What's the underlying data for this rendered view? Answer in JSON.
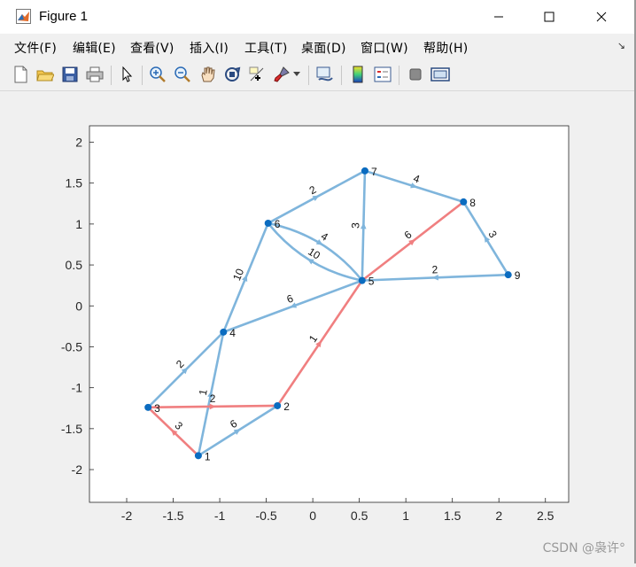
{
  "window": {
    "title": "Figure 1"
  },
  "menu": [
    "文件(F)",
    "编辑(E)",
    "查看(V)",
    "插入(I)",
    "工具(T)",
    "桌面(D)",
    "窗口(W)",
    "帮助(H)"
  ],
  "toolbar_icons": [
    "new-figure-icon",
    "open-icon",
    "save-icon",
    "print-icon",
    "pointer-icon",
    "zoom-in-icon",
    "zoom-out-icon",
    "pan-icon",
    "rotate-3d-icon",
    "data-cursor-icon",
    "brush-icon",
    "link-plot-icon",
    "colorbar-icon",
    "legend-icon",
    "hide-plot-tools-icon",
    "show-plot-tools-icon"
  ],
  "watermark": "CSDN @袅许°",
  "colors": {
    "edge": "#7fb5dc",
    "path": "#f07f80",
    "node": "#0b6cc0"
  },
  "chart_data": {
    "type": "graph",
    "xlim": [
      -2.4,
      2.75
    ],
    "ylim": [
      -2.4,
      2.2
    ],
    "xticks": [
      "-2",
      "-1.5",
      "-1",
      "-0.5",
      "0",
      "0.5",
      "1",
      "1.5",
      "2",
      "2.5"
    ],
    "yticks": [
      "2",
      "1.5",
      "1",
      "0.5",
      "0",
      "-0.5",
      "-1",
      "-1.5",
      "-2"
    ],
    "nodes": [
      {
        "id": "1",
        "x": -1.23,
        "y": -1.83
      },
      {
        "id": "2",
        "x": -0.38,
        "y": -1.22
      },
      {
        "id": "3",
        "x": -1.77,
        "y": -1.24
      },
      {
        "id": "4",
        "x": -0.96,
        "y": -0.32
      },
      {
        "id": "5",
        "x": 0.53,
        "y": 0.31
      },
      {
        "id": "6",
        "x": -0.48,
        "y": 1.01
      },
      {
        "id": "7",
        "x": 0.56,
        "y": 1.65
      },
      {
        "id": "8",
        "x": 1.62,
        "y": 1.27
      },
      {
        "id": "9",
        "x": 2.1,
        "y": 0.38
      }
    ],
    "edges": [
      {
        "from": "1",
        "to": "2",
        "w": "6",
        "path": false
      },
      {
        "from": "1",
        "to": "3",
        "w": "3",
        "path": true
      },
      {
        "from": "1",
        "to": "4",
        "w": "1",
        "path": false
      },
      {
        "from": "3",
        "to": "2",
        "w": "2",
        "path": true
      },
      {
        "from": "3",
        "to": "4",
        "w": "2",
        "path": false
      },
      {
        "from": "2",
        "to": "5",
        "w": "1",
        "path": true
      },
      {
        "from": "4",
        "to": "6",
        "w": "10",
        "path": false
      },
      {
        "from": "5",
        "to": "4",
        "w": "6",
        "path": false
      },
      {
        "from": "6",
        "to": "7",
        "w": "2",
        "path": false
      },
      {
        "from": "6",
        "to": "5",
        "w": "4",
        "path": false,
        "curve": -0.18
      },
      {
        "from": "5",
        "to": "6",
        "w": "10",
        "path": false,
        "curve": -0.18
      },
      {
        "from": "5",
        "to": "7",
        "w": "3",
        "path": false
      },
      {
        "from": "5",
        "to": "8",
        "w": "6",
        "path": true
      },
      {
        "from": "7",
        "to": "8",
        "w": "4",
        "path": false
      },
      {
        "from": "9",
        "to": "5",
        "w": "2",
        "path": false
      },
      {
        "from": "9",
        "to": "8",
        "w": "3",
        "path": false
      }
    ]
  }
}
